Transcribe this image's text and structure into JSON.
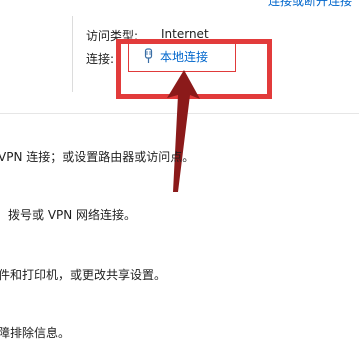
{
  "top_link": "连接或断开连接",
  "connection_panel": {
    "access_type_label": "访问类型:",
    "access_type_value": "Internet",
    "connection_label": "连接:",
    "connection_name": "本地连接",
    "connection_icon": "network-adapter-icon"
  },
  "tasks": [
    "VPN 连接；或设置路由器或访问点。",
    "拨号或 VPN 网络连接。",
    "件和打印机，或更改共享设置。",
    "障排除信息。"
  ],
  "colors": {
    "link": "#0066cc",
    "highlight": "#e23b3b",
    "arrow": "#8b1a1a"
  }
}
